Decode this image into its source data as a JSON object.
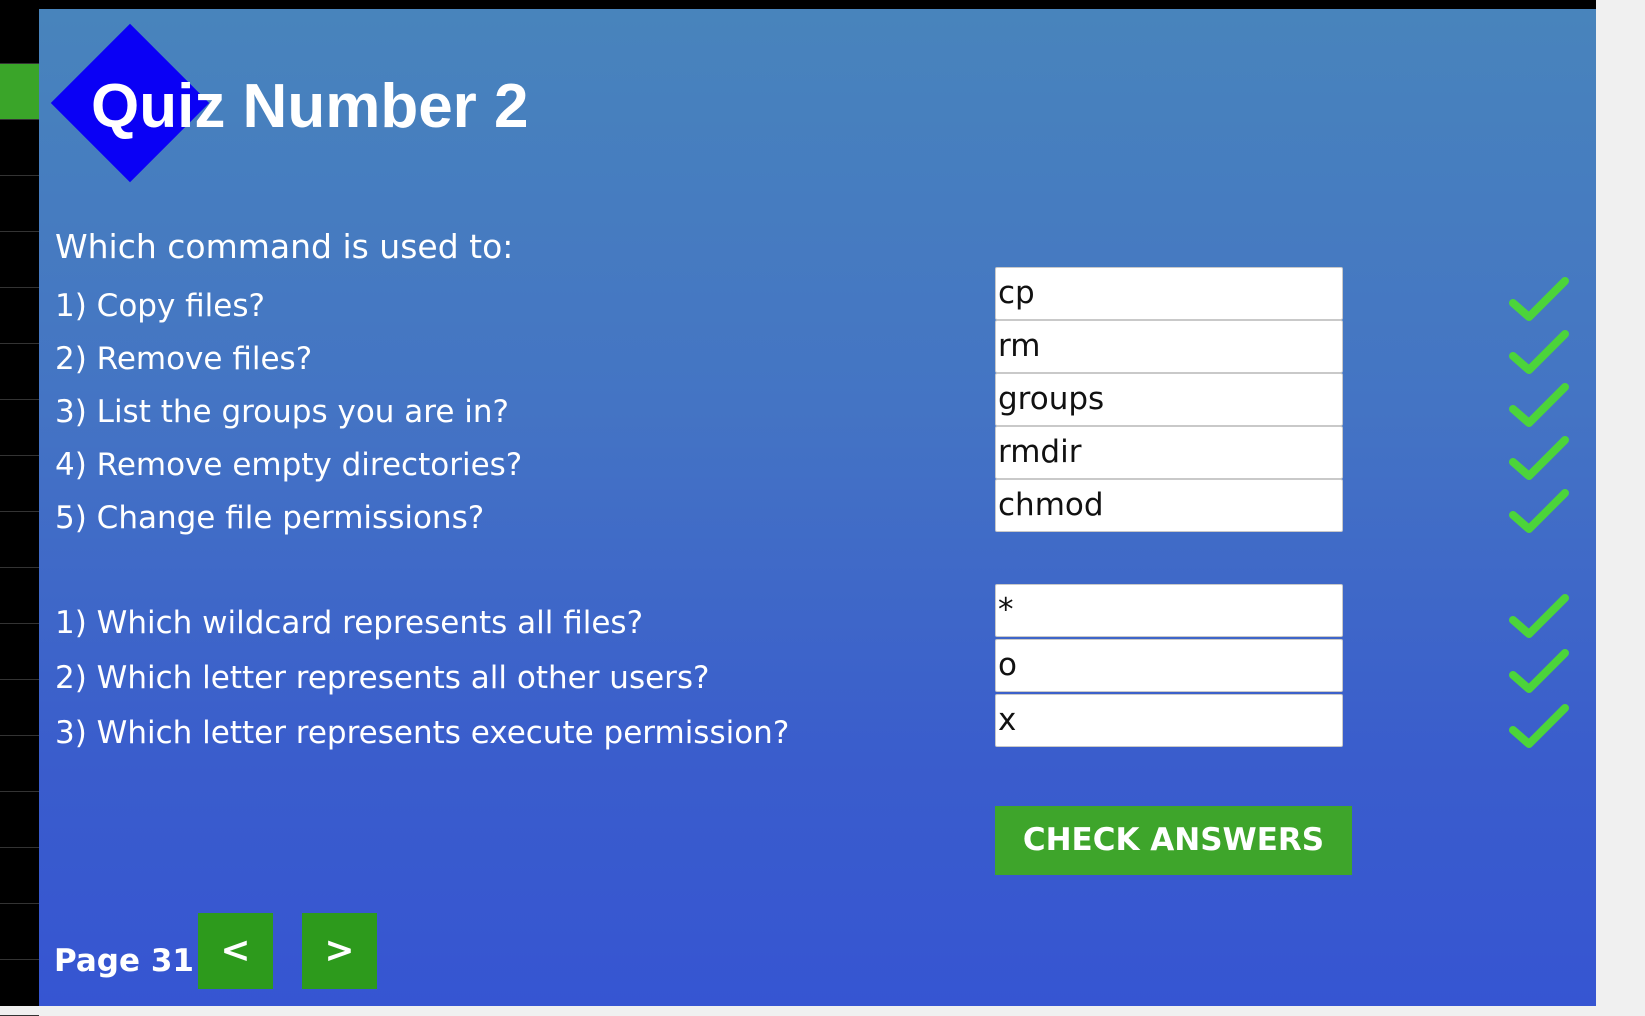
{
  "title": "Quiz Number 2",
  "intro": "Which command is used to:",
  "section1": [
    {
      "question": "1) Copy files?",
      "answer": "cp"
    },
    {
      "question": "2) Remove files?",
      "answer": "rm"
    },
    {
      "question": "3) List the groups you are in?",
      "answer": "groups"
    },
    {
      "question": "4) Remove empty directories?",
      "answer": "rmdir"
    },
    {
      "question": "5) Change file permissions?",
      "answer": "chmod"
    }
  ],
  "section2": [
    {
      "question": "1) Which wildcard represents all files?",
      "answer": "*"
    },
    {
      "question": "2) Which letter represents all other users?",
      "answer": "o"
    },
    {
      "question": "3) Which letter represents execute permission?",
      "answer": "x"
    }
  ],
  "check_button": "CHECK ANSWERS",
  "page_label": "Page 31",
  "nav": {
    "prev": "<",
    "next": ">"
  },
  "icons": {
    "result": "checkmark-icon",
    "logo": "diamond-logo-icon"
  },
  "colors": {
    "accent_green": "#3ea52b",
    "tick_green": "#4cd43a",
    "logo_blue": "#0a00f5"
  }
}
